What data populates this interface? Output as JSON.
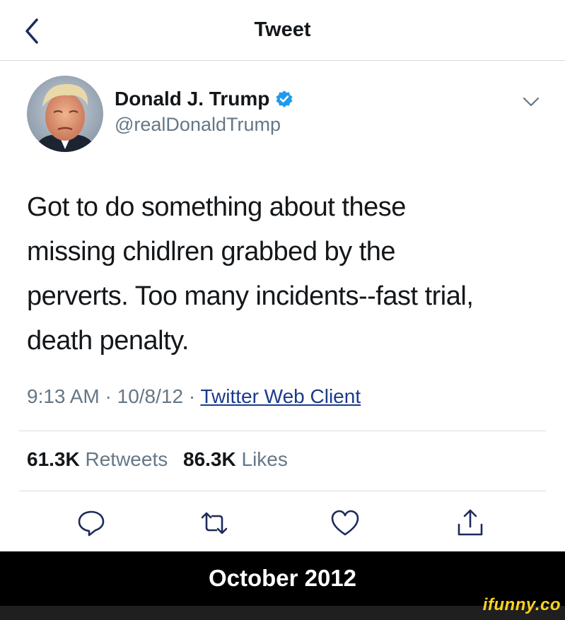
{
  "header": {
    "back_icon": "chevron-left-icon",
    "title": "Tweet"
  },
  "author": {
    "avatar_icon": "profile-photo",
    "display_name": "Donald J. Trump",
    "verified_icon": "verified-badge-icon",
    "handle": "@realDonaldTrump",
    "menu_icon": "chevron-down-icon"
  },
  "tweet": {
    "lines": [
      "Got to do something about these",
      "missing chidlren grabbed by the",
      "perverts. Too many incidents--fast trial,",
      "death penalty."
    ],
    "time": "9:13 AM",
    "separator": "·",
    "date": "10/8/12",
    "source": "Twitter Web Client"
  },
  "stats": {
    "retweets_count": "61.3K",
    "retweets_label": "Retweets",
    "likes_count": "86.3K",
    "likes_label": "Likes"
  },
  "actions": [
    {
      "icon": "reply-icon"
    },
    {
      "icon": "retweet-icon"
    },
    {
      "icon": "like-heart-icon"
    },
    {
      "icon": "share-icon"
    }
  ],
  "banner": {
    "text": "October 2012"
  },
  "watermark": {
    "text": "ifunny.co"
  },
  "colors": {
    "text_primary": "#14171a",
    "text_secondary": "#657786",
    "link": "#1b3a8c",
    "verified": "#1d9bf0",
    "banner_bg": "#000000",
    "watermark": "#ffd21f"
  }
}
